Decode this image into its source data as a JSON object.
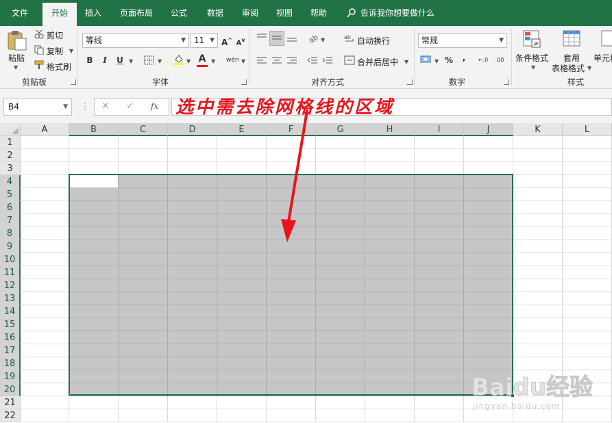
{
  "tabs": [
    "文件",
    "开始",
    "插入",
    "页面布局",
    "公式",
    "数据",
    "审阅",
    "视图",
    "帮助"
  ],
  "active_tab": "开始",
  "tell_me": "告诉我你想要做什么",
  "ribbon": {
    "clipboard": {
      "paste": "粘贴",
      "cut": "剪切",
      "copy": "复制",
      "format_painter": "格式刷",
      "label": "剪贴板"
    },
    "font": {
      "name": "等线",
      "size": "11",
      "bold": "B",
      "italic": "I",
      "underline": "U",
      "label": "字体"
    },
    "alignment": {
      "wrap": "自动换行",
      "merge": "合并后居中",
      "label": "对齐方式"
    },
    "number": {
      "format": "常规",
      "percent": "%",
      "comma": ",",
      "label": "数字"
    },
    "styles": {
      "conditional": "条件格式",
      "table_line1": "套用",
      "table_line2": "表格格式",
      "cell_styles": "单元格",
      "label": "样式"
    }
  },
  "formula_bar": {
    "name_box": "B4",
    "cancel": "✕",
    "enter": "✓",
    "fx": "fx",
    "formula": ""
  },
  "annotation": "选中需去除网格线的区域",
  "sheet": {
    "columns": [
      "A",
      "B",
      "C",
      "D",
      "E",
      "F",
      "G",
      "H",
      "I",
      "J",
      "K",
      "L"
    ],
    "rows": [
      "1",
      "2",
      "3",
      "4",
      "5",
      "6",
      "7",
      "8",
      "9",
      "10",
      "11",
      "12",
      "13",
      "14",
      "15",
      "16",
      "17",
      "18",
      "19",
      "20",
      "21",
      "22"
    ],
    "selection": "B4:J20",
    "active_cell": "B4",
    "selection_color": "#c6c6c6",
    "accent": "#217346"
  },
  "watermark": {
    "brand": "Baidu经验",
    "url": "jingyan.baidu.com"
  }
}
